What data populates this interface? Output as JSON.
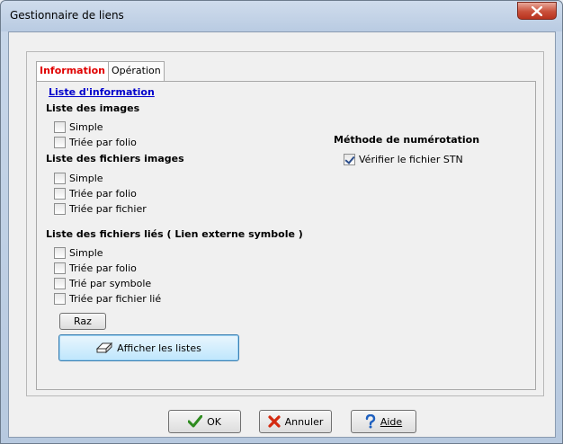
{
  "window": {
    "title": "Gestionnaire de liens"
  },
  "tabs": [
    {
      "label": "Information"
    },
    {
      "label": "Opération"
    }
  ],
  "info": {
    "link_label": "Liste d'information",
    "images": {
      "title": "Liste des images",
      "options": [
        {
          "label": "Simple",
          "checked": false
        },
        {
          "label": "Triée par folio",
          "checked": false
        }
      ]
    },
    "image_files": {
      "title": "Liste des fichiers images",
      "options": [
        {
          "label": "Simple",
          "checked": false
        },
        {
          "label": "Triée par folio",
          "checked": false
        },
        {
          "label": "Triée par fichier",
          "checked": false
        }
      ]
    },
    "linked_files": {
      "title": "Liste des fichiers liés ( Lien externe symbole )",
      "options": [
        {
          "label": "Simple",
          "checked": false
        },
        {
          "label": "Triée par folio",
          "checked": false
        },
        {
          "label": "Trié par symbole",
          "checked": false
        },
        {
          "label": "Triée par fichier lié",
          "checked": false
        }
      ]
    },
    "numbering": {
      "title": "Méthode de numérotation",
      "options": [
        {
          "label": "Vérifier le fichier STN",
          "checked": true
        }
      ]
    },
    "reset_label": "Raz",
    "show_label": "Afficher les listes"
  },
  "footer": {
    "ok_label": "OK",
    "cancel_label": "Annuler",
    "help_label": "Aide"
  },
  "colors": {
    "active_tab": "#e00000",
    "link": "#0000cc",
    "ok_check": "#2e8b1f",
    "cancel_x": "#d42a10",
    "help_q": "#1d5fbf"
  }
}
